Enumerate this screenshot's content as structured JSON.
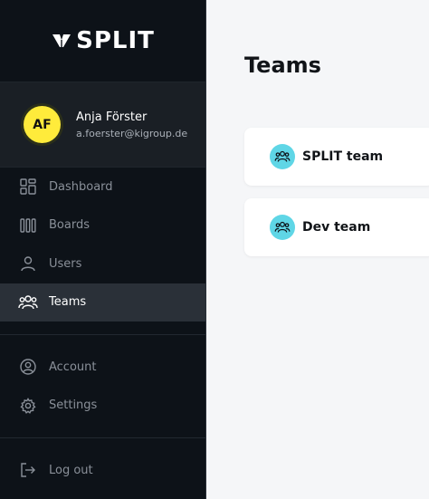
{
  "brand": {
    "name": "SPLIT",
    "accent": "#5fd6e6"
  },
  "user": {
    "initials": "AF",
    "name": "Anja Förster",
    "email": "a.foerster@kigroup.de"
  },
  "nav": {
    "main": [
      {
        "label": "Dashboard",
        "icon": "grid-icon"
      },
      {
        "label": "Boards",
        "icon": "columns-icon"
      },
      {
        "label": "Users",
        "icon": "user-icon"
      },
      {
        "label": "Teams",
        "icon": "team-icon",
        "active": true
      }
    ],
    "secondary": [
      {
        "label": "Account",
        "icon": "account-circle-icon"
      },
      {
        "label": "Settings",
        "icon": "gear-icon"
      }
    ],
    "footer": [
      {
        "label": "Log out",
        "icon": "logout-icon"
      }
    ]
  },
  "page": {
    "title": "Teams",
    "teams": [
      {
        "name": "SPLIT team",
        "icon": "team-icon"
      },
      {
        "name": "Dev team",
        "icon": "team-icon"
      }
    ]
  }
}
